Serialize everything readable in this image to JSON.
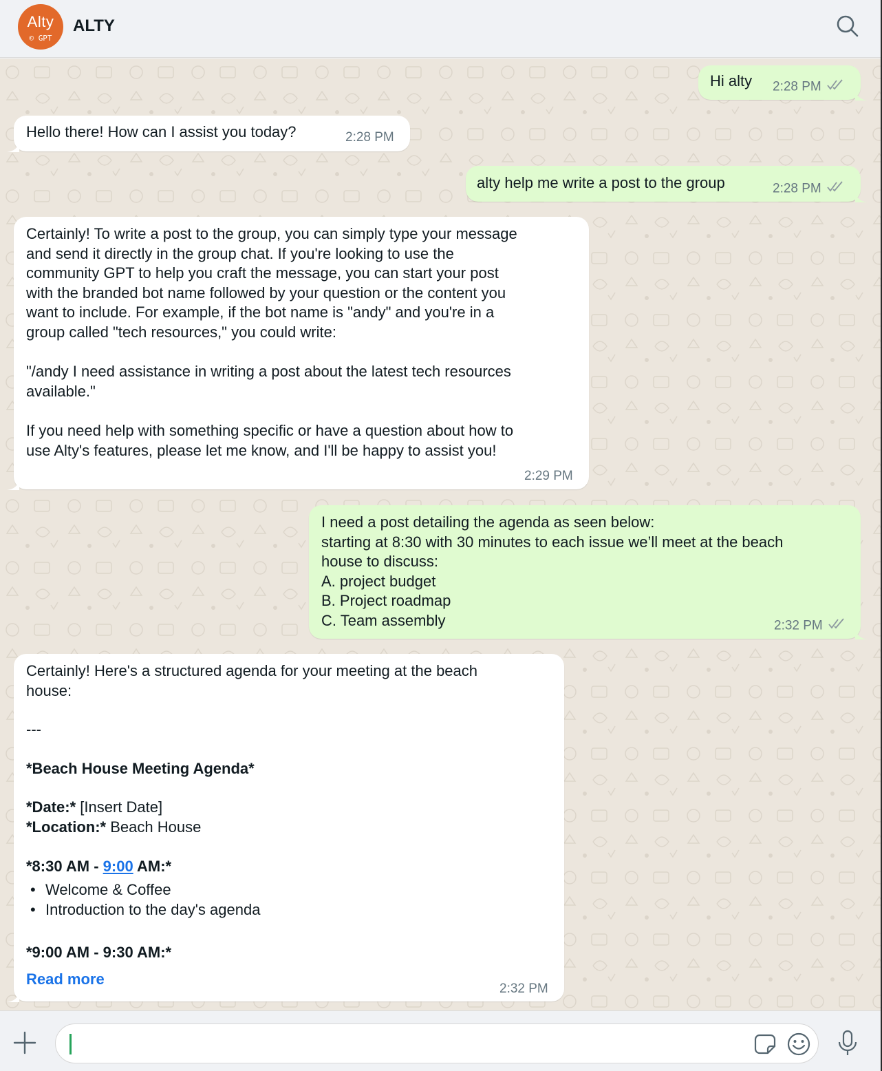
{
  "header": {
    "title": "ALTY",
    "avatar_logo": "Alty",
    "avatar_sub": "GPT",
    "search_icon": "search-icon"
  },
  "messages": [
    {
      "direction": "out",
      "text": "Hi alty",
      "time": "2:28 PM",
      "status": "read"
    },
    {
      "direction": "in",
      "text": "Hello there! How can I assist you today?",
      "time": "2:28 PM"
    },
    {
      "direction": "out",
      "text": "alty help me write a post to the group",
      "time": "2:28 PM",
      "status": "read"
    },
    {
      "direction": "in",
      "text": "Certainly! To write a post to the group, you can simply type your message\nand send it directly in the group chat. If you're looking to use the\ncommunity GPT to help you craft the message, you can start your post\nwith the branded bot name followed by your question or the content you\nwant to include. For example, if the bot name is \"andy\" and you're in a\ngroup called \"tech resources,\" you could write:\n\n\"/andy I need assistance in writing a post about the latest tech resources\navailable.\"\n\nIf you need help with something specific or have a question about how to\nuse Alty's features, please let me know, and I'll be happy to assist you!",
      "time": "2:29 PM"
    },
    {
      "direction": "out",
      "text": "I need a post detailing the agenda as seen below:\nstarting at 8:30 with 30 minutes to each issue we’ll meet at the beach\nhouse to discuss:\nA. project budget\nB. Project roadmap\nC. Team assembly",
      "time": "2:32 PM",
      "status": "read"
    },
    {
      "direction": "in",
      "time": "2:32 PM",
      "intro": "Certainly! Here's a structured agenda for your meeting at the beach\nhouse:",
      "separator": "---",
      "agenda_title": "*Beach House Meeting Agenda*",
      "date_label": "*Date:*",
      "date_value": " [Insert Date]",
      "location_label": "*Location:*",
      "location_value": " Beach House",
      "slot1_start": "*8:30 AM - ",
      "slot1_link": "9:00",
      "slot1_end": " AM:*",
      "slot1_items": [
        "Welcome & Coffee",
        "Introduction to the day's agenda"
      ],
      "slot2": "*9:00 AM - 9:30 AM:*",
      "read_more": "Read more"
    }
  ],
  "composer": {
    "value": "",
    "placeholder": ""
  }
}
